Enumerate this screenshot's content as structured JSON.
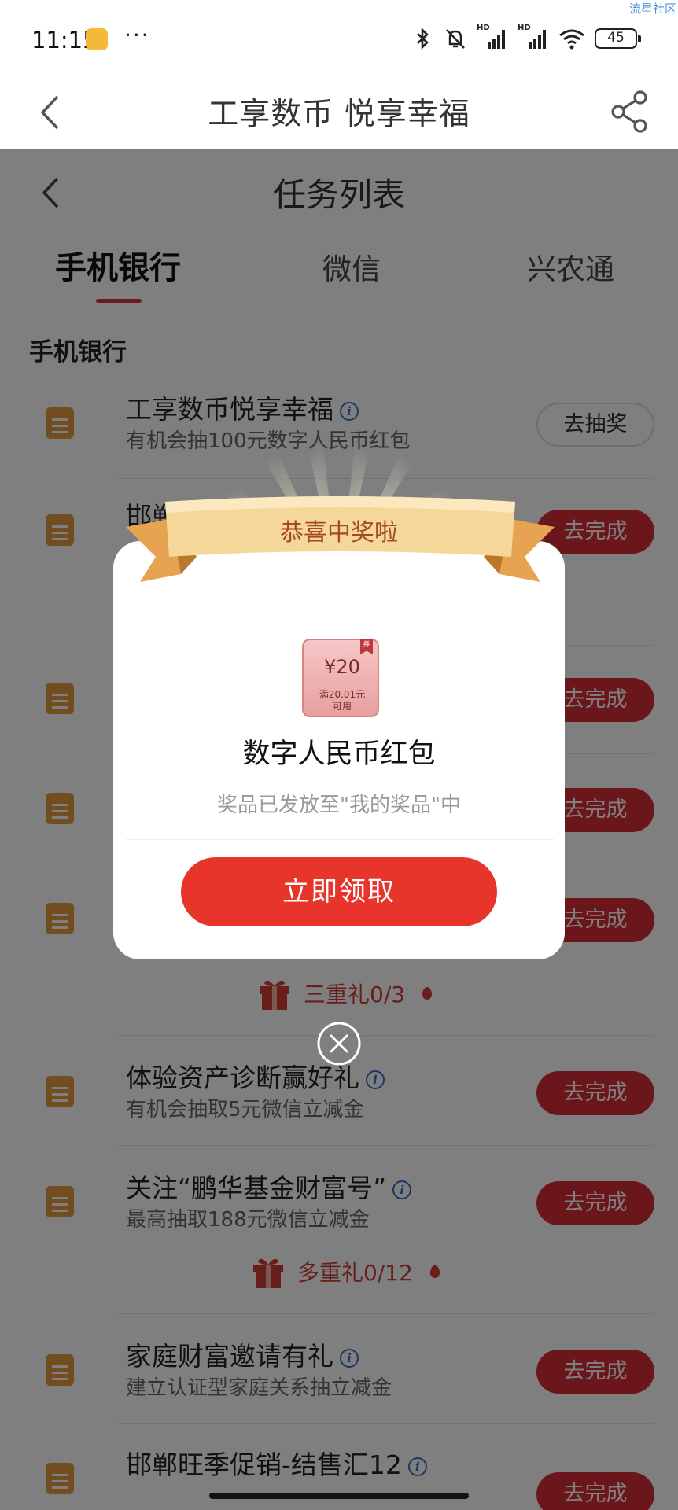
{
  "status_bar": {
    "time": "11:15",
    "more": "···",
    "signal_label_1": "HD",
    "signal_label_2": "HD",
    "battery": "45",
    "watermark": "流星社区"
  },
  "header": {
    "title": "工享数币 悦享幸福"
  },
  "page": {
    "subtitle": "任务列表",
    "tabs": [
      "手机银行",
      "微信",
      "兴农通"
    ],
    "section_title": "手机银行",
    "tasks": [
      {
        "title": "工享数币悦享幸福",
        "desc": "有机会抽100元数字人民币红包",
        "button": "去抽奖"
      },
      {
        "title": "邯郸",
        "desc": "",
        "button": "去完成"
      },
      {
        "title": "",
        "desc": "",
        "button": "去完成"
      },
      {
        "title": "",
        "desc": "",
        "button": "去完成"
      },
      {
        "title": "",
        "desc": "",
        "button": "去完成"
      },
      {
        "title": "体验资产诊断赢好礼",
        "desc": "有机会抽取5元微信立减金",
        "button": "去完成"
      },
      {
        "title": "关注“鹏华基金财富号”",
        "desc": "最高抽取188元微信立减金",
        "button": "去完成"
      },
      {
        "title": "家庭财富邀请有礼",
        "desc": "建立认证型家庭关系抽立减金",
        "button": "去完成"
      },
      {
        "title": "邯郸旺季促销-结售汇12",
        "desc": "",
        "button": "去完成"
      }
    ],
    "gift_rows": [
      {
        "label": "三重礼0/3"
      },
      {
        "label": "多重礼0/12"
      }
    ]
  },
  "modal": {
    "ribbon_text": "恭喜中奖啦",
    "coupon": {
      "amount": "¥20",
      "condition_line1": "满20.01元",
      "condition_line2": "可用",
      "tag": "券"
    },
    "prize_name": "数字人民币红包",
    "prize_note": "奖品已发放至\"我的奖品\"中",
    "claim_button": "立即领取"
  },
  "colors": {
    "accent_red": "#e8352b",
    "button_red": "#d52d35",
    "ribbon_gold": "#f2cf8a",
    "icon_orange": "#e39b40",
    "info_blue": "#3b6fc6"
  }
}
